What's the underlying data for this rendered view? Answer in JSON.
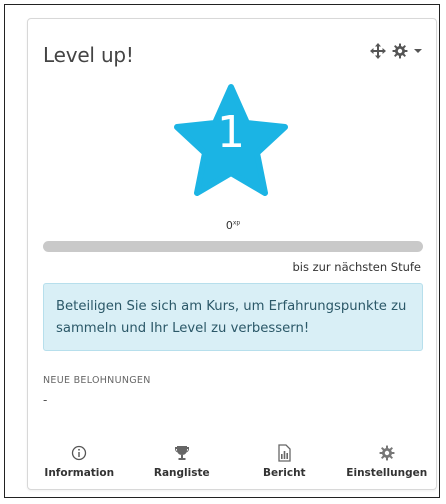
{
  "block": {
    "title": "Level up!",
    "level": "1",
    "xp_value": "0",
    "xp_unit": "xp",
    "progress": 0,
    "next_level_text": "bis zur nächsten Stufe",
    "notice": "Beteiligen Sie sich am Kurs, um Erfahrungspunkte zu sammeln und Ihr Level zu verbessern!",
    "rewards_heading": "NEUE BELOHNUNGEN",
    "rewards_value": "-"
  },
  "header_icons": [
    "move-icon",
    "gear-icon",
    "caret-down-icon"
  ],
  "nav": [
    {
      "label": "Information",
      "icon": "info-icon"
    },
    {
      "label": "Rangliste",
      "icon": "trophy-icon"
    },
    {
      "label": "Bericht",
      "icon": "report-icon"
    },
    {
      "label": "Einstellungen",
      "icon": "gear-icon"
    }
  ],
  "colors": {
    "star": "#1bb4e4",
    "progress_track": "#c9c9c9",
    "notice_bg": "#d9eff6",
    "notice_text": "#2b5868"
  }
}
